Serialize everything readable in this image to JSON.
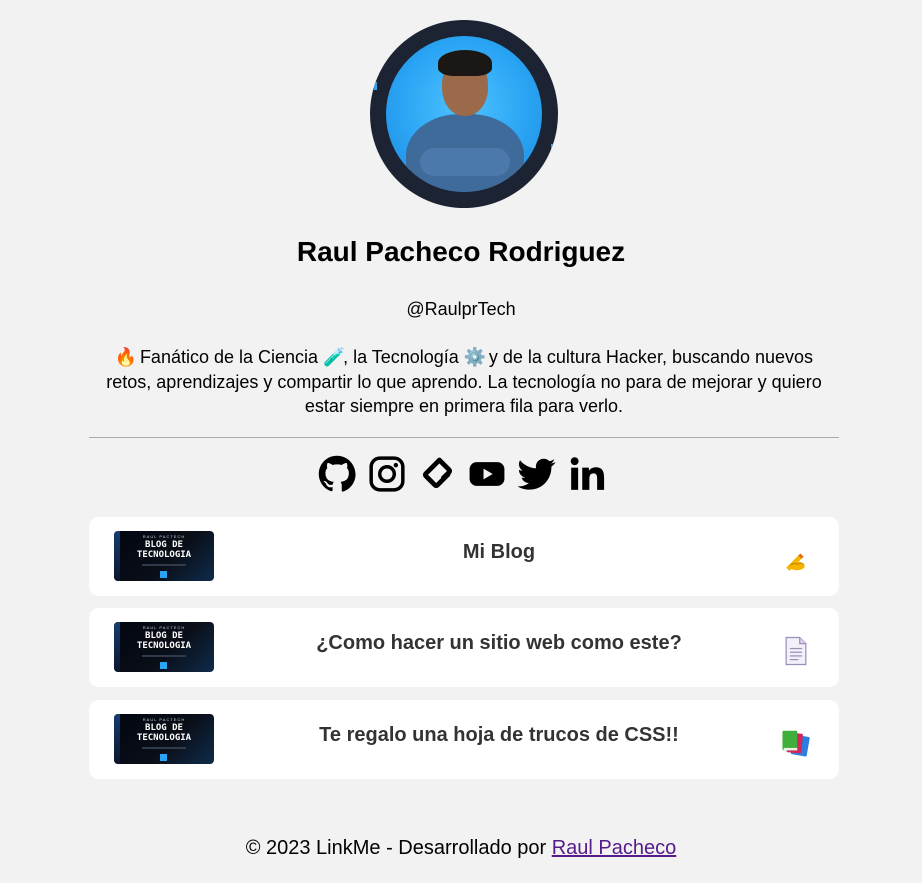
{
  "profile": {
    "name": "Raul Pacheco Rodriguez",
    "handle": "@RaulprTech",
    "bio": {
      "part1": "Fanático de la Ciencia",
      "part2": ", la Tecnología",
      "part3": "y de la cultura Hacker, buscando nuevos retos, aprendizajes y compartir lo que aprendo. La tecnología no para de mejorar y quiero estar siempre en primera fila para verlo.",
      "emoji_fire": "🔥",
      "emoji_test_tube": "🧪",
      "emoji_gear": "⚙️"
    }
  },
  "social": [
    {
      "name": "github",
      "icon": "github-icon"
    },
    {
      "name": "instagram",
      "icon": "instagram-icon"
    },
    {
      "name": "platzi",
      "icon": "platzi-icon"
    },
    {
      "name": "youtube",
      "icon": "youtube-icon"
    },
    {
      "name": "twitter",
      "icon": "twitter-icon"
    },
    {
      "name": "linkedin",
      "icon": "linkedin-icon"
    }
  ],
  "thumbnail": {
    "small": "RAUL PACTECH",
    "title_line1": "BLOG DE",
    "title_line2": "TECNOLOGIA"
  },
  "links": [
    {
      "title": "Mi Blog",
      "emoji": "✍️"
    },
    {
      "title": "¿Como hacer un sitio web como este?",
      "emoji": "📄"
    },
    {
      "title": "Te regalo una hoja de trucos de CSS!!",
      "emoji": "📚"
    }
  ],
  "footer": {
    "text": "© 2023 LinkMe - Desarrollado por",
    "link": "Raul Pacheco"
  },
  "colors": {
    "background": "#f2f2f2",
    "card": "#ffffff",
    "avatar_ring": "#1c2433",
    "avatar_bg": "#2aa4f4",
    "link_visited": "#551a8b"
  }
}
